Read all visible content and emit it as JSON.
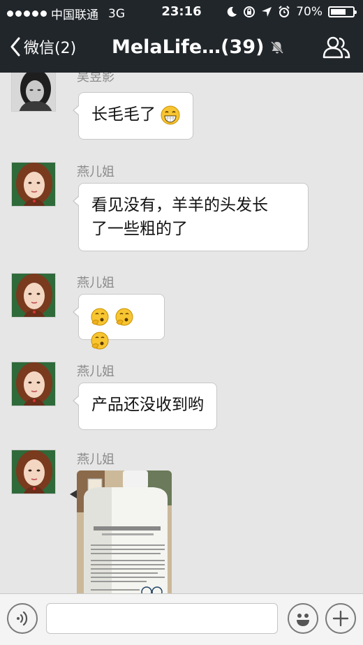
{
  "status_bar": {
    "carrier": "中国联通",
    "network": "3G",
    "time": "23:16",
    "battery": "70%",
    "battery_level": 0.7
  },
  "nav": {
    "back_label": "微信(2)",
    "title": "MelaLife…(39)"
  },
  "messages": [
    {
      "sender": "吴昱影",
      "text": "长毛毛了",
      "emoji": "grin"
    },
    {
      "sender": "燕儿姐",
      "text_line1": "看见没有，羊羊的头发长",
      "text_line2": "了一些粗的了"
    },
    {
      "sender": "燕儿姐",
      "emoji": "thinking",
      "emoji_count": 3
    },
    {
      "sender": "燕儿姐",
      "text": "产品还没收到哟"
    },
    {
      "sender": "燕儿姐",
      "type": "image"
    }
  ],
  "input": {
    "placeholder": "",
    "value": ""
  },
  "icons": {
    "back": "chevron-left-icon",
    "mute": "bell-slash-icon",
    "group": "people-icon",
    "voice": "voice-icon",
    "emoji": "smiley-icon",
    "more": "plus-icon"
  }
}
